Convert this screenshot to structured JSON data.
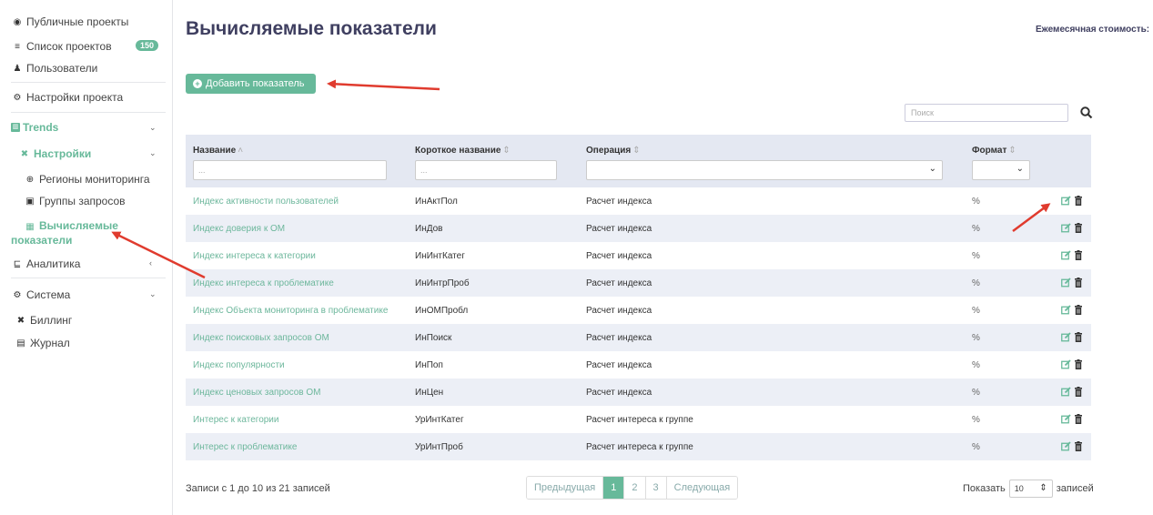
{
  "sidebar": {
    "public_projects": "Публичные проекты",
    "projects_list": "Список проектов",
    "projects_count": "150",
    "users": "Пользователи",
    "project_settings": "Настройки проекта",
    "trends": "Trends",
    "settings": "Настройки",
    "monitoring_regions": "Регионы мониторинга",
    "query_groups": "Группы запросов",
    "computed_line1": "Вычисляемые",
    "computed_line2": "показатели",
    "analytics": "Аналитика",
    "system": "Система",
    "billing": "Биллинг",
    "journal": "Журнал"
  },
  "header": {
    "title": "Вычисляемые показатели",
    "monthly_cost": "Ежемесячная стоимость:"
  },
  "toolbar": {
    "add_label": "Добавить показатель",
    "search_placeholder": "Поиск"
  },
  "table": {
    "columns": [
      "Название",
      "Короткое название",
      "Операция",
      "Формат"
    ],
    "filter_placeholder": "...",
    "rows": [
      {
        "name": "Индекс активности пользователей",
        "short": "ИнАктПол",
        "op": "Расчет индекса",
        "fmt": "%"
      },
      {
        "name": "Индекс доверия к ОМ",
        "short": "ИнДов",
        "op": "Расчет индекса",
        "fmt": "%"
      },
      {
        "name": "Индекс интереса к категории",
        "short": "ИнИнтКатег",
        "op": "Расчет индекса",
        "fmt": "%"
      },
      {
        "name": "Индекс интереса к проблематике",
        "short": "ИнИнтрПроб",
        "op": "Расчет индекса",
        "fmt": "%"
      },
      {
        "name": "Индекс Объекта мониторинга в проблематике",
        "short": "ИнОМПробл",
        "op": "Расчет индекса",
        "fmt": "%"
      },
      {
        "name": "Индекс поисковых запросов ОМ",
        "short": "ИнПоиск",
        "op": "Расчет индекса",
        "fmt": "%"
      },
      {
        "name": "Индекс популярности",
        "short": "ИнПоп",
        "op": "Расчет индекса",
        "fmt": "%"
      },
      {
        "name": "Индекс ценовых запросов ОМ",
        "short": "ИнЦен",
        "op": "Расчет индекса",
        "fmt": "%"
      },
      {
        "name": "Интерес к категории",
        "short": "УрИнтКатег",
        "op": "Расчет интереса к группе",
        "fmt": "%"
      },
      {
        "name": "Интерес к проблематике",
        "short": "УрИнтПроб",
        "op": "Расчет интереса к группе",
        "fmt": "%"
      }
    ]
  },
  "footer": {
    "info": "Записи с 1 до 10 из 21 записей",
    "prev": "Предыдущая",
    "pages": [
      "1",
      "2",
      "3"
    ],
    "next": "Следующая",
    "show_label": "Показать",
    "page_size": "10",
    "records_label": "записей"
  },
  "colors": {
    "accent": "#67b99a",
    "title": "#3f3f60",
    "arrow": "#e03b2e"
  }
}
